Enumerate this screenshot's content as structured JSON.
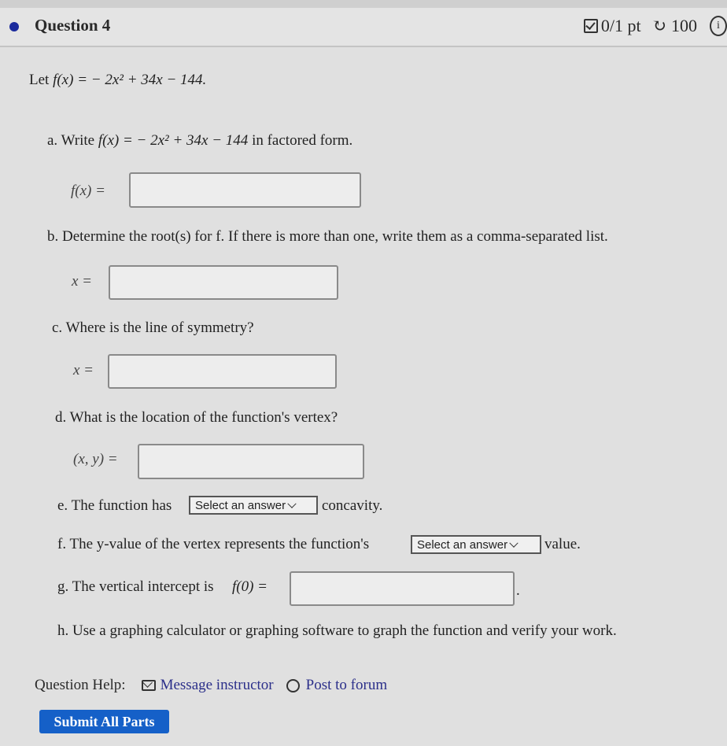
{
  "header": {
    "title": "Question 4",
    "score": "0/1 pt",
    "attempts": "100",
    "icons": {
      "status": "checkbox-icon",
      "retry": "retry-icon",
      "info": "info-icon"
    }
  },
  "problem": {
    "intro_prefix": "Let",
    "function": "f(x) = − 2x² + 34x − 144."
  },
  "parts": {
    "a": {
      "prompt_prefix": "a. Write",
      "prompt_math": "f(x) = − 2x² + 34x − 144",
      "prompt_suffix": "in factored form.",
      "answer_label": "f(x) =",
      "value": ""
    },
    "b": {
      "prompt": "b. Determine the root(s) for f. If there is more than one, write them as a comma-separated list.",
      "answer_label": "x =",
      "value": ""
    },
    "c": {
      "prompt": "c. Where is the line of symmetry?",
      "answer_label": "x =",
      "value": ""
    },
    "d": {
      "prompt": "d. What is the location of the function's vertex?",
      "answer_label": "(x, y) =",
      "value": ""
    },
    "e": {
      "prefix": "e. The function has",
      "select": "Select an answer",
      "suffix": "concavity."
    },
    "f": {
      "prefix": "f. The y-value of the vertex represents the function's",
      "select": "Select an answer",
      "suffix": "value."
    },
    "g": {
      "prefix": "g. The vertical intercept is",
      "answer_label": "f(0) =",
      "suffix": ".",
      "value": ""
    },
    "h": {
      "prompt": "h. Use a graphing calculator or graphing software to graph the function and verify your work."
    }
  },
  "help": {
    "label": "Question Help:",
    "message_instructor": "Message instructor",
    "post_to_forum": "Post to forum"
  },
  "submit_label": "Submit All Parts",
  "colors": {
    "accent": "#1560c8",
    "link": "#2b2f8a",
    "dot": "#1a2a9c"
  }
}
